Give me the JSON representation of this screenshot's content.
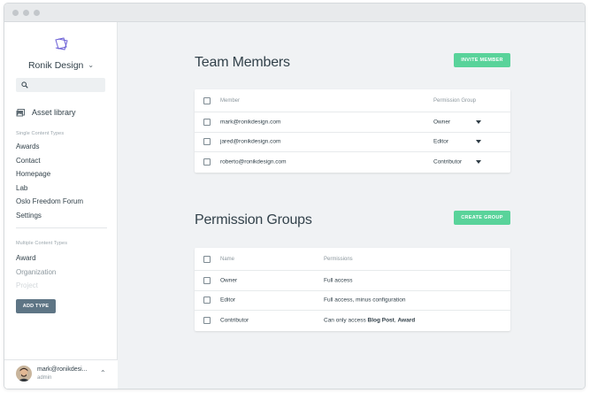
{
  "sidebar": {
    "brand": "Ronik Design",
    "asset_library": "Asset library",
    "single_label": "Single Content Types",
    "single_items": [
      "Awards",
      "Contact",
      "Homepage",
      "Lab",
      "Oslo Freedom Forum",
      "Settings"
    ],
    "multiple_label": "Multiple Content Types",
    "multiple_items": [
      "Award",
      "Organization",
      "Project"
    ],
    "add_type": "ADD TYPE"
  },
  "user": {
    "name": "mark@ronikdesi...",
    "role": "admin"
  },
  "team": {
    "title": "Team Members",
    "invite_button": "INVITE MEMBER",
    "headers": {
      "member": "Member",
      "group": "Permission Group"
    },
    "rows": [
      {
        "email": "mark@ronikdesign.com",
        "group": "Owner"
      },
      {
        "email": "jared@ronikdesign.com",
        "group": "Editor"
      },
      {
        "email": "roberto@ronikdesign.com",
        "group": "Contributor"
      }
    ]
  },
  "groups": {
    "title": "Permission Groups",
    "create_button": "CREATE GROUP",
    "headers": {
      "name": "Name",
      "permissions": "Permissions"
    },
    "rows": [
      {
        "name": "Owner",
        "permissions": "Full access"
      },
      {
        "name": "Editor",
        "permissions": "Full access, minus configuration"
      },
      {
        "name": "Contributor",
        "permissions_prefix": "Can only access ",
        "perm_a": "Blog Post",
        "perm_sep": ", ",
        "perm_b": "Award"
      }
    ]
  },
  "colors": {
    "accent_green": "#59d39a",
    "button_slate": "#5e7585",
    "logo_purple": "#6b5fd6"
  },
  "icons": [
    "app-logo-icon",
    "chevron-down-icon",
    "search-icon",
    "image-library-icon",
    "chevron-up-icon",
    "dropdown-caret-icon",
    "checkbox-icon"
  ]
}
